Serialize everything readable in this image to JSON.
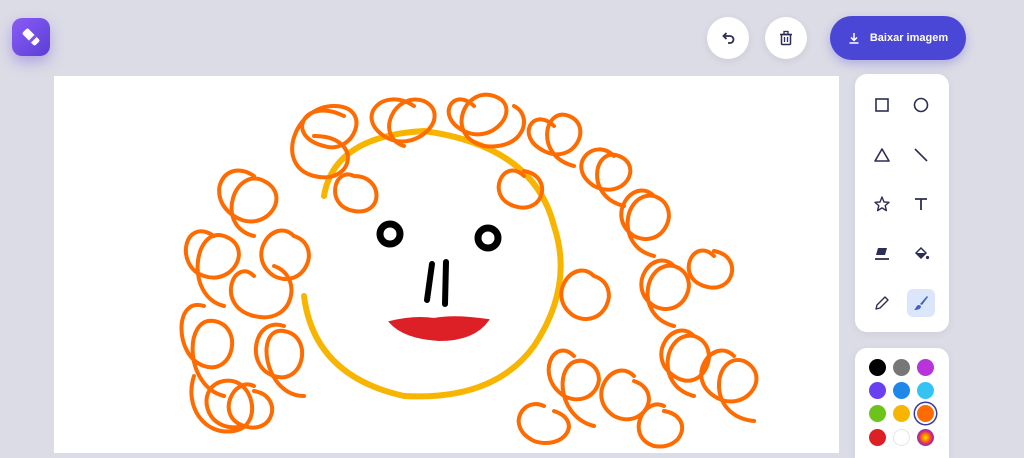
{
  "header": {
    "logo_icon": "pen-eraser-icon",
    "undo_icon": "undo-icon",
    "clear_icon": "trash-icon",
    "download_label": "Baixar imagem",
    "download_icon": "download-icon",
    "accent": "#4a46d6"
  },
  "tools": [
    {
      "name": "rectangle-tool",
      "icon": "square-icon",
      "active": false
    },
    {
      "name": "circle-tool",
      "icon": "circle-icon",
      "active": false
    },
    {
      "name": "triangle-tool",
      "icon": "triangle-icon",
      "active": false
    },
    {
      "name": "line-tool",
      "icon": "line-icon",
      "active": false
    },
    {
      "name": "star-tool",
      "icon": "star-icon",
      "active": false
    },
    {
      "name": "text-tool",
      "icon": "text-icon",
      "active": false
    },
    {
      "name": "eraser-tool",
      "icon": "eraser-icon",
      "active": false
    },
    {
      "name": "fill-tool",
      "icon": "paint-bucket-icon",
      "active": false
    },
    {
      "name": "pencil-tool",
      "icon": "pencil-icon",
      "active": false
    },
    {
      "name": "brush-tool",
      "icon": "brush-icon",
      "active": true
    }
  ],
  "colors": [
    {
      "hex": "#000000",
      "selected": false
    },
    {
      "hex": "#777777",
      "selected": false
    },
    {
      "hex": "#b833d9",
      "selected": false
    },
    {
      "hex": "#6a3ff0",
      "selected": false
    },
    {
      "hex": "#1f86ea",
      "selected": false
    },
    {
      "hex": "#35c3f3",
      "selected": false
    },
    {
      "hex": "#6cc41a",
      "selected": false
    },
    {
      "hex": "#f8b500",
      "selected": false
    },
    {
      "hex": "#fe6b00",
      "selected": true
    },
    {
      "hex": "#dd1f26",
      "selected": false
    },
    {
      "hex": "#ffffff",
      "selected": false
    },
    {
      "hex": "rainbow",
      "selected": false
    }
  ],
  "drawing": {
    "hair_color": "#fe6b00",
    "face_color": "#f8b500",
    "mouth_color": "#dd1f26",
    "features_color": "#000000"
  }
}
